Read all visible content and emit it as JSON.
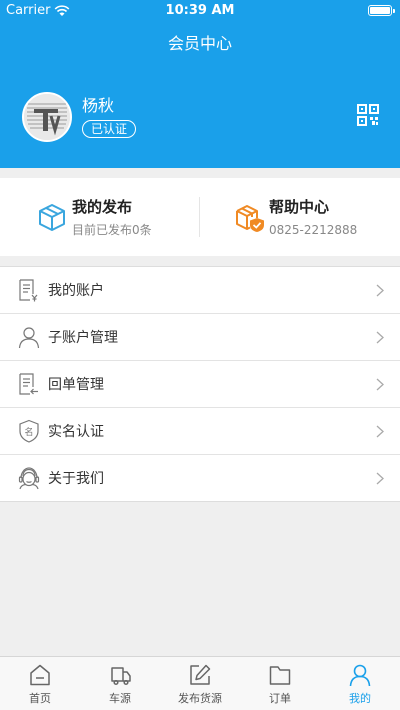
{
  "status_bar": {
    "carrier": "Carrier",
    "time": "10:39 AM"
  },
  "nav": {
    "title": "会员中心"
  },
  "profile": {
    "name": "杨秋",
    "badge": "已认证"
  },
  "quick": {
    "publish": {
      "title": "我的发布",
      "subtitle": "目前已发布0条"
    },
    "help": {
      "title": "帮助中心",
      "subtitle": "0825-2212888"
    }
  },
  "menu": {
    "items": [
      {
        "label": "我的账户",
        "icon": "account-doc-icon"
      },
      {
        "label": "子账户管理",
        "icon": "user-icon"
      },
      {
        "label": "回单管理",
        "icon": "receipt-icon"
      },
      {
        "label": "实名认证",
        "icon": "name-shield-icon"
      },
      {
        "label": "关于我们",
        "icon": "support-icon"
      }
    ]
  },
  "tabbar": {
    "items": [
      {
        "label": "首页",
        "icon": "home-icon"
      },
      {
        "label": "车源",
        "icon": "truck-icon"
      },
      {
        "label": "发布货源",
        "icon": "edit-icon"
      },
      {
        "label": "订单",
        "icon": "folder-icon"
      },
      {
        "label": "我的",
        "icon": "person-icon"
      }
    ],
    "active_index": 4
  },
  "colors": {
    "primary": "#1aa0ea",
    "help_orange": "#f08a24",
    "publish_blue": "#3aa6de"
  }
}
